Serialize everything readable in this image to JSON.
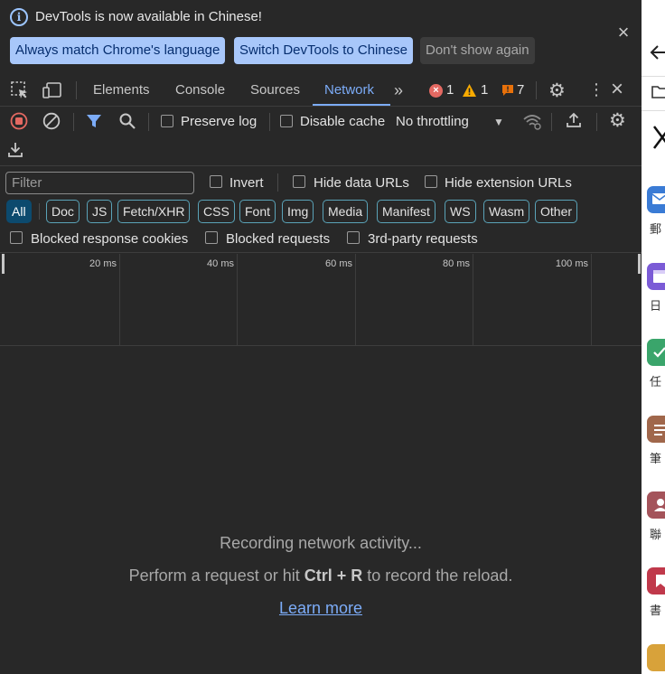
{
  "infobar": {
    "message": "DevTools is now available in Chinese!",
    "btn_match": "Always match Chrome's language",
    "btn_switch": "Switch DevTools to Chinese",
    "btn_dont_show": "Don't show again",
    "close_icon": "close-icon"
  },
  "tabs": [
    "Elements",
    "Console",
    "Sources",
    "Network"
  ],
  "active_tab": "Network",
  "counts": {
    "errors": "1",
    "warnings": "1",
    "issues": "7"
  },
  "network_toolbar": {
    "preserve_log": "Preserve log",
    "disable_cache": "Disable cache",
    "throttling": "No throttling"
  },
  "filter": {
    "placeholder": "Filter",
    "invert": "Invert",
    "hide_data_urls": "Hide data URLs",
    "hide_extension_urls": "Hide extension URLs",
    "types": [
      "All",
      "Doc",
      "JS",
      "Fetch/XHR",
      "CSS",
      "Font",
      "Img",
      "Media",
      "Manifest",
      "WS",
      "Wasm",
      "Other"
    ],
    "active_type": "All",
    "blocked_response_cookies": "Blocked response cookies",
    "blocked_requests": "Blocked requests",
    "third_party_requests": "3rd-party requests"
  },
  "timeline": {
    "ticks": [
      "20 ms",
      "40 ms",
      "60 ms",
      "80 ms",
      "100 ms"
    ]
  },
  "empty_state": {
    "line1": "Recording network activity...",
    "line2_pre": "Perform a request or hit ",
    "line2_key": "Ctrl + R",
    "line2_post": " to record the reload.",
    "learn_more": "Learn more"
  },
  "side_panel": {
    "labels": [
      "郵",
      "日",
      "任",
      "筆",
      "聯",
      "書"
    ],
    "colors": {
      "blue": "#3a7bd5",
      "purple": "#7b5bd6",
      "green": "#3aa56b",
      "brown": "#a0674b",
      "rose": "#a4535a",
      "crimson": "#c0394b",
      "gold": "#d8a23a"
    }
  },
  "colors": {
    "accent": "#7cacf8",
    "background": "#282828",
    "error": "#e46962",
    "warning": "#f9ab00",
    "issue": "#e8710a"
  }
}
